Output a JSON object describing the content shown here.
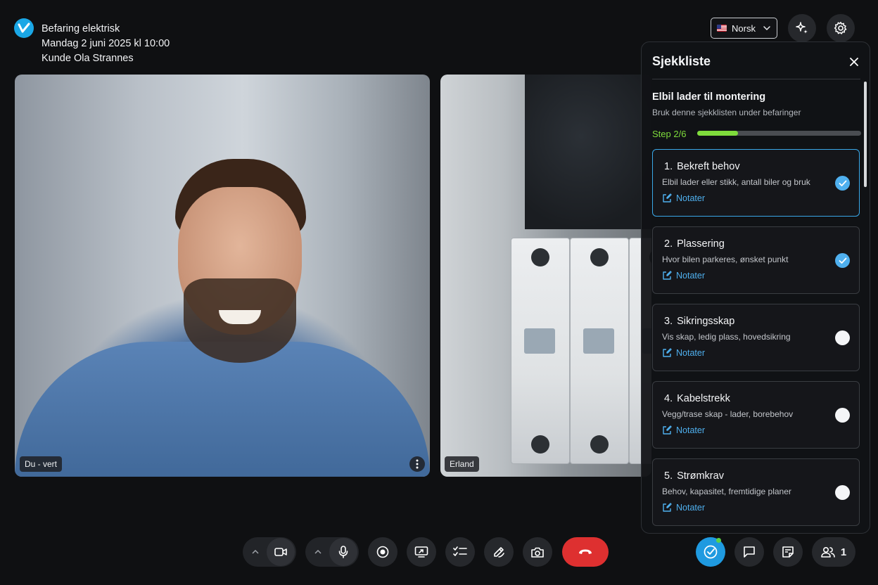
{
  "meeting": {
    "title": "Befaring elektrisk",
    "datetime": "Mandag 2 juni 2025 kl 10:00",
    "customer": "Kunde Ola Strannes"
  },
  "language": {
    "selected": "Norsk",
    "flag": "us-flag-icon"
  },
  "tiles": {
    "host_label": "Du - vert",
    "remote_label": "Erland"
  },
  "checklist": {
    "panel_title": "Sjekkliste",
    "name": "Elbil lader til montering",
    "description": "Bruk denne sjekklisten under befaringer",
    "step_label": "Step 2/6",
    "progress_fraction": 0.25,
    "items": [
      {
        "num": "1.",
        "title": "Bekreft behov",
        "desc": "Elbil lader eller stikk, antall biler og bruk",
        "notes": "Notater",
        "done": true,
        "active": true
      },
      {
        "num": "2.",
        "title": "Plassering",
        "desc": "Hvor bilen parkeres, ønsket punkt",
        "notes": "Notater",
        "done": true,
        "active": false
      },
      {
        "num": "3.",
        "title": "Sikringsskap",
        "desc": "Vis skap, ledig plass, hovedsikring",
        "notes": "Notater",
        "done": false,
        "active": false
      },
      {
        "num": "4.",
        "title": "Kabelstrekk",
        "desc": "Vegg/trase skap - lader, borebehov",
        "notes": "Notater",
        "done": false,
        "active": false
      },
      {
        "num": "5.",
        "title": "Strømkrav",
        "desc": "Behov, kapasitet, fremtidige planer",
        "notes": "Notater",
        "done": false,
        "active": false
      }
    ]
  },
  "toolbar": {
    "participants_count": "1",
    "colors": {
      "accent": "#1f9ae0",
      "hangup": "#de3030",
      "progress": "#7fdc3c"
    }
  }
}
